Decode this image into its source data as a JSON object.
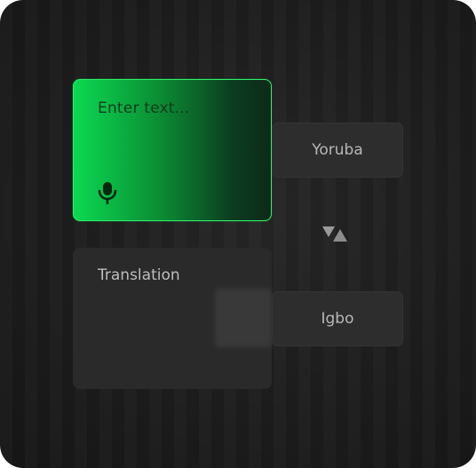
{
  "input": {
    "placeholder": "Enter text...",
    "mic_icon": "microphone-icon"
  },
  "source_language": {
    "label": "Yoruba"
  },
  "swap": {
    "icon": "swap-languages-icon"
  },
  "output": {
    "label": "Translation"
  },
  "target_language": {
    "label": "Igbo"
  },
  "colors": {
    "accent_green": "#0bd951",
    "background": "#1d1d1d",
    "card": "#2a2a2a"
  }
}
